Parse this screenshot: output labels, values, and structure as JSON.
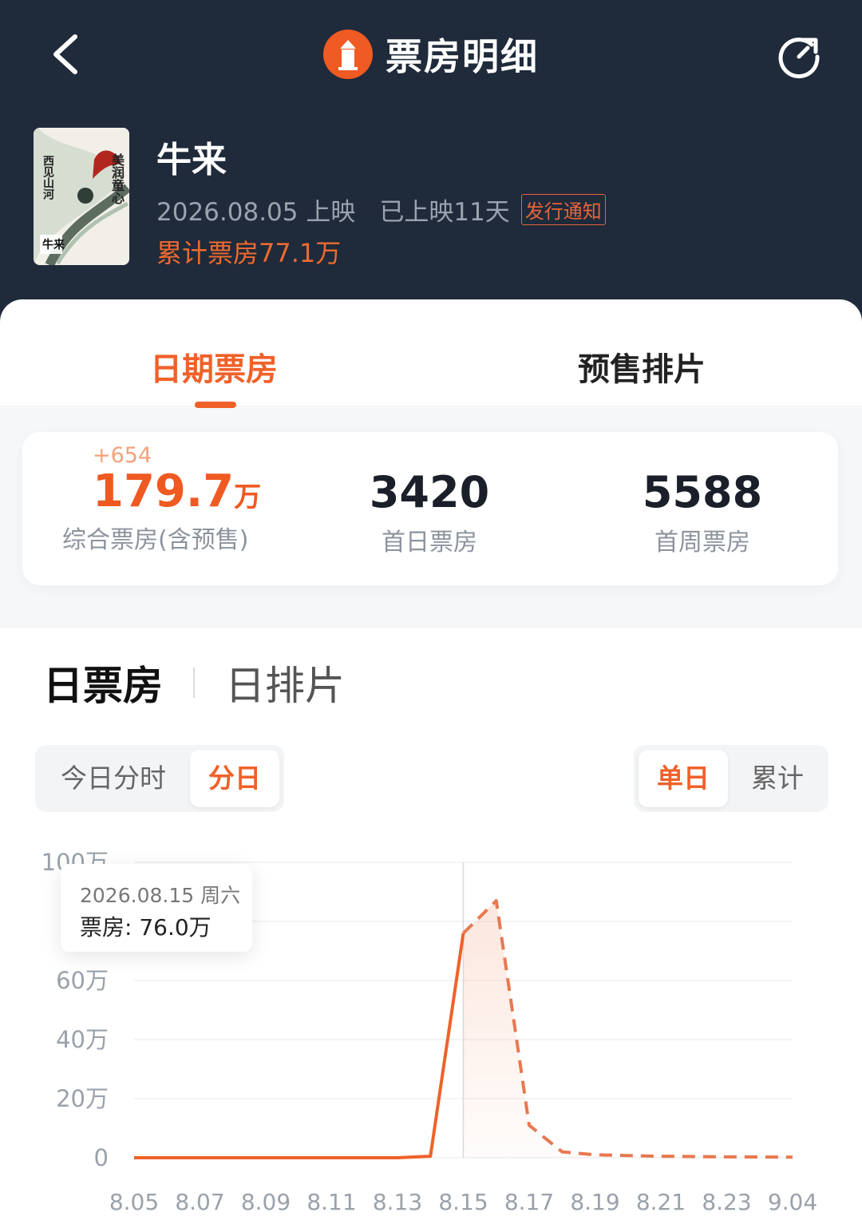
{
  "header": {
    "title": "票房明细",
    "back_icon": "chevron-left-icon",
    "logo_icon": "lighthouse-logo-icon",
    "refresh_icon": "refresh-icon"
  },
  "movie": {
    "name": "牛来",
    "release": "2026.08.05 上映",
    "days": "已上映11天",
    "notice": "发行通知",
    "total": "累计票房77.1万",
    "poster_text": [
      "美润童心",
      "西见山河",
      "牛来"
    ]
  },
  "tabs": [
    "日期票房",
    "预售排片"
  ],
  "stats": {
    "delta": "+654",
    "main_value": "179.7",
    "main_unit": "万",
    "main_label": "综合票房(含预售)",
    "first_day_value": "3420",
    "first_day_label": "首日票房",
    "first_week_value": "5588",
    "first_week_label": "首周票房"
  },
  "section_tabs": [
    "日票房",
    "日排片"
  ],
  "segment_left": [
    "今日分时",
    "分日"
  ],
  "segment_right": [
    "单日",
    "累计"
  ],
  "tooltip": {
    "date": "2026.08.15 周六",
    "value": "票房: 76.0万"
  },
  "colors": {
    "accent": "#f0612a",
    "header_bg": "#1f2a3a"
  },
  "chart_data": {
    "type": "line",
    "y_labels": [
      "100万",
      "60万",
      "40万",
      "20万",
      "0"
    ],
    "x_labels": [
      "8.05",
      "8.07",
      "8.09",
      "8.11",
      "8.13",
      "8.15",
      "8.17",
      "8.19",
      "8.21",
      "8.23",
      "9.04"
    ],
    "ylim": [
      0,
      100
    ],
    "solid_series": [
      {
        "x": "8.05",
        "y": 0
      },
      {
        "x": "8.07",
        "y": 0
      },
      {
        "x": "8.09",
        "y": 0
      },
      {
        "x": "8.11",
        "y": 0
      },
      {
        "x": "8.13",
        "y": 0
      },
      {
        "x": "8.14",
        "y": 0.5
      },
      {
        "x": "8.15",
        "y": 76
      }
    ],
    "dashed_series": [
      {
        "x": "8.15",
        "y": 76
      },
      {
        "x": "8.16",
        "y": 87
      },
      {
        "x": "8.17",
        "y": 11
      },
      {
        "x": "8.18",
        "y": 2
      },
      {
        "x": "8.19",
        "y": 1
      },
      {
        "x": "8.21",
        "y": 0.5
      },
      {
        "x": "8.23",
        "y": 0.3
      },
      {
        "x": "9.04",
        "y": 0.2
      }
    ],
    "highlight_x": "8.15"
  }
}
